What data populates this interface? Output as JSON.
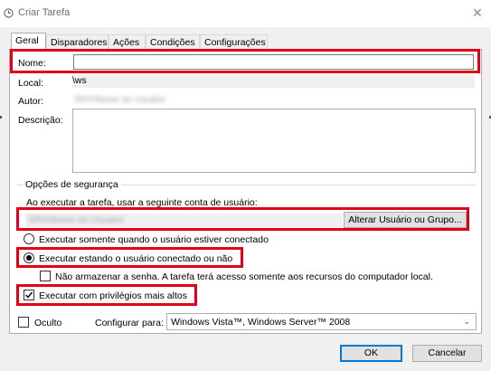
{
  "window": {
    "title": "Criar Tarefa"
  },
  "tabs": [
    {
      "label": "Geral",
      "active": true
    },
    {
      "label": "Disparadores"
    },
    {
      "label": "Ações"
    },
    {
      "label": "Condições"
    },
    {
      "label": "Configurações"
    }
  ],
  "general": {
    "name_label": "Nome:",
    "name_value": "",
    "location_label": "Local:",
    "location_value": "\\ws",
    "author_label": "Autor:",
    "author_value": "SRV\\Nome do Usuário",
    "description_label": "Descrição:",
    "description_value": ""
  },
  "security": {
    "group_label": "Opções de segurança",
    "account_prompt": "Ao executar a tarefa, usar a seguinte conta de usuário:",
    "account_value": "SRV\\Nome do Usuário",
    "change_user_button": "Alterar Usuário ou Grupo...",
    "radio_logged_on": "Executar somente quando o usuário estiver conectado",
    "radio_whether_logged": "Executar estando o usuário conectado ou não",
    "radio_selected": "whether_logged",
    "no_store_password": "Não armazenar a senha. A tarefa terá acesso somente aos recursos do computador local.",
    "no_store_password_checked": false,
    "highest_privileges": "Executar com privilégios mais altos",
    "highest_privileges_checked": true
  },
  "bottom": {
    "hidden_label": "Oculto",
    "hidden_checked": false,
    "configure_label": "Configurar para:",
    "configure_value": "Windows Vista™, Windows Server™ 2008"
  },
  "buttons": {
    "ok": "OK",
    "cancel": "Cancelar"
  },
  "colors": {
    "highlight": "#e0001a",
    "accent": "#0078d7"
  }
}
